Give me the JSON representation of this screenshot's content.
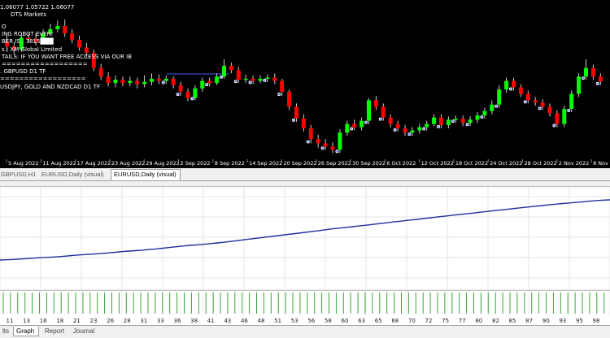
{
  "price_chart": {
    "header_values": "1.06077 1.05722 1.06077",
    "broker": "DTS Markets",
    "overlay_lines": [
      "O",
      "ING ROBOT EVER!",
      "BER IS : 7815███",
      "s : XM Global Limited",
      "TAILS: IF YOU WANT FREE ACCESS VIA OUR IB",
      "==================",
      ". GBPUSD D1 TF",
      "==================",
      "USDJPY, GOLD AND NZDCAD D1 TF"
    ],
    "date_labels": [
      "5 Aug 2022",
      "11 Aug 2022",
      "17 Aug 2022",
      "23 Aug 2022",
      "29 Aug 2022",
      "2 Sep 2022",
      "8 Sep 2022",
      "14 Sep 2022",
      "20 Sep 2022",
      "26 Sep 2022",
      "30 Sep 2022",
      "6 Oct 2022",
      "12 Oct 2022",
      "18 Oct 2022",
      "24 Oct 2022",
      "28 Oct 2022",
      "2 Nov 2022",
      "8 Nov"
    ],
    "bull_color": "#00ff00",
    "bear_color": "#ff0000",
    "candles": [
      {
        "o": 1.026,
        "c": 1.024,
        "h": 1.029,
        "l": 1.0215
      },
      {
        "o": 1.024,
        "c": 1.0225,
        "h": 1.026,
        "l": 1.0205
      },
      {
        "o": 1.0225,
        "c": 1.028,
        "h": 1.0295,
        "l": 1.0215
      },
      {
        "o": 1.028,
        "c": 1.0275,
        "h": 1.03,
        "l": 1.0255
      },
      {
        "o": 1.0275,
        "c": 1.026,
        "h": 1.03,
        "l": 1.0245
      },
      {
        "o": 1.026,
        "c": 1.03,
        "h": 1.032,
        "l": 1.025
      },
      {
        "o": 1.03,
        "c": 1.032,
        "h": 1.0345,
        "l": 1.029
      },
      {
        "o": 1.032,
        "c": 1.0335,
        "h": 1.036,
        "l": 1.0305
      },
      {
        "o": 1.0335,
        "c": 1.03,
        "h": 1.0365,
        "l": 1.0285
      },
      {
        "o": 1.03,
        "c": 1.027,
        "h": 1.032,
        "l": 1.0255
      },
      {
        "o": 1.027,
        "c": 1.0235,
        "h": 1.029,
        "l": 1.022
      },
      {
        "o": 1.0235,
        "c": 1.021,
        "h": 1.0255,
        "l": 1.019
      },
      {
        "o": 1.021,
        "c": 1.014,
        "h": 1.0225,
        "l": 1.0125
      },
      {
        "o": 1.014,
        "c": 1.01,
        "h": 1.016,
        "l": 1.0085
      },
      {
        "o": 1.01,
        "c": 1.007,
        "h": 1.012,
        "l": 1.0055
      },
      {
        "o": 1.007,
        "c": 1.0085,
        "h": 1.0105,
        "l": 1.005
      },
      {
        "o": 1.0085,
        "c": 1.007,
        "h": 1.01,
        "l": 1.0055
      },
      {
        "o": 1.007,
        "c": 1.008,
        "h": 1.01,
        "l": 1.0055
      },
      {
        "o": 1.008,
        "c": 1.0065,
        "h": 1.0095,
        "l": 1.0045
      },
      {
        "o": 1.0065,
        "c": 1.0075,
        "h": 1.0105,
        "l": 1.005
      },
      {
        "o": 1.0075,
        "c": 1.009,
        "h": 1.0115,
        "l": 1.006
      },
      {
        "o": 1.009,
        "c": 1.008,
        "h": 1.011,
        "l": 1.0065
      },
      {
        "o": 1.008,
        "c": 1.009,
        "h": 1.0105,
        "l": 1.0065
      },
      {
        "o": 1.009,
        "c": 1.006,
        "h": 1.01,
        "l": 1.0045
      },
      {
        "o": 1.006,
        "c": 1.003,
        "h": 1.0075,
        "l": 1.001
      },
      {
        "o": 1.003,
        "c": 1.0,
        "h": 1.0045,
        "l": 0.9985
      },
      {
        "o": 1.0,
        "c": 1.0045,
        "h": 1.006,
        "l": 0.999
      },
      {
        "o": 1.0045,
        "c": 1.008,
        "h": 1.0095,
        "l": 1.003
      },
      {
        "o": 1.008,
        "c": 1.007,
        "h": 1.0095,
        "l": 1.0055
      },
      {
        "o": 1.007,
        "c": 1.01,
        "h": 1.0115,
        "l": 1.006
      },
      {
        "o": 1.01,
        "c": 1.015,
        "h": 1.018,
        "l": 1.009
      },
      {
        "o": 1.015,
        "c": 1.013,
        "h": 1.0165,
        "l": 1.0115
      },
      {
        "o": 1.013,
        "c": 1.0085,
        "h": 1.0145,
        "l": 1.007
      },
      {
        "o": 1.0085,
        "c": 1.009,
        "h": 1.011,
        "l": 1.007
      },
      {
        "o": 1.009,
        "c": 1.008,
        "h": 1.0105,
        "l": 1.0065
      },
      {
        "o": 1.008,
        "c": 1.009,
        "h": 1.0105,
        "l": 1.007
      },
      {
        "o": 1.009,
        "c": 1.0095,
        "h": 1.011,
        "l": 1.0075
      },
      {
        "o": 1.0095,
        "c": 1.008,
        "h": 1.0115,
        "l": 1.0065
      },
      {
        "o": 1.008,
        "c": 1.003,
        "h": 1.009,
        "l": 1.001
      },
      {
        "o": 1.003,
        "c": 0.996,
        "h": 1.004,
        "l": 0.9945
      },
      {
        "o": 0.996,
        "c": 0.9905,
        "h": 0.9975,
        "l": 0.989
      },
      {
        "o": 0.9905,
        "c": 0.986,
        "h": 0.9925,
        "l": 0.9845
      },
      {
        "o": 0.986,
        "c": 0.981,
        "h": 0.9875,
        "l": 0.979
      },
      {
        "o": 0.981,
        "c": 0.979,
        "h": 0.983,
        "l": 0.977
      },
      {
        "o": 0.979,
        "c": 0.9775,
        "h": 0.981,
        "l": 0.976
      },
      {
        "o": 0.9775,
        "c": 0.976,
        "h": 0.9795,
        "l": 0.9745
      },
      {
        "o": 0.976,
        "c": 0.984,
        "h": 0.9855,
        "l": 0.9745
      },
      {
        "o": 0.984,
        "c": 0.988,
        "h": 0.9895,
        "l": 0.9825
      },
      {
        "o": 0.988,
        "c": 0.9865,
        "h": 0.99,
        "l": 0.985
      },
      {
        "o": 0.9865,
        "c": 0.9895,
        "h": 0.991,
        "l": 0.985
      },
      {
        "o": 0.9895,
        "c": 0.999,
        "h": 1.0,
        "l": 0.988
      },
      {
        "o": 0.999,
        "c": 0.996,
        "h": 1.001,
        "l": 0.9945
      },
      {
        "o": 0.996,
        "c": 0.991,
        "h": 0.9975,
        "l": 0.9895
      },
      {
        "o": 0.991,
        "c": 0.988,
        "h": 0.9925,
        "l": 0.9865
      },
      {
        "o": 0.988,
        "c": 0.986,
        "h": 0.9895,
        "l": 0.9845
      },
      {
        "o": 0.986,
        "c": 0.984,
        "h": 0.9875,
        "l": 0.9825
      },
      {
        "o": 0.984,
        "c": 0.985,
        "h": 0.9865,
        "l": 0.9825
      },
      {
        "o": 0.985,
        "c": 0.9865,
        "h": 0.988,
        "l": 0.9835
      },
      {
        "o": 0.9865,
        "c": 0.988,
        "h": 0.9895,
        "l": 0.985
      },
      {
        "o": 0.988,
        "c": 0.991,
        "h": 0.9925,
        "l": 0.987
      },
      {
        "o": 0.991,
        "c": 0.9875,
        "h": 0.9925,
        "l": 0.986
      },
      {
        "o": 0.9875,
        "c": 0.99,
        "h": 0.9915,
        "l": 0.986
      },
      {
        "o": 0.99,
        "c": 0.9905,
        "h": 0.992,
        "l": 0.9885
      },
      {
        "o": 0.9905,
        "c": 0.9885,
        "h": 0.992,
        "l": 0.987
      },
      {
        "o": 0.9885,
        "c": 0.99,
        "h": 0.9915,
        "l": 0.987
      },
      {
        "o": 0.99,
        "c": 0.992,
        "h": 0.9935,
        "l": 0.9885
      },
      {
        "o": 0.992,
        "c": 0.994,
        "h": 0.9955,
        "l": 0.9905
      },
      {
        "o": 0.994,
        "c": 0.997,
        "h": 0.999,
        "l": 0.9925
      },
      {
        "o": 0.997,
        "c": 1.004,
        "h": 1.006,
        "l": 0.9955
      },
      {
        "o": 1.004,
        "c": 1.008,
        "h": 1.0095,
        "l": 1.0025
      },
      {
        "o": 1.008,
        "c": 1.005,
        "h": 1.0095,
        "l": 1.0035
      },
      {
        "o": 1.005,
        "c": 1.002,
        "h": 1.0065,
        "l": 1.0005
      },
      {
        "o": 1.002,
        "c": 0.999,
        "h": 1.0035,
        "l": 0.9975
      },
      {
        "o": 0.999,
        "c": 0.998,
        "h": 1.0005,
        "l": 0.9965
      },
      {
        "o": 0.998,
        "c": 0.996,
        "h": 0.9995,
        "l": 0.9945
      },
      {
        "o": 0.996,
        "c": 0.993,
        "h": 0.9975,
        "l": 0.9915
      },
      {
        "o": 0.993,
        "c": 0.988,
        "h": 0.9945,
        "l": 0.9865
      },
      {
        "o": 0.988,
        "c": 0.995,
        "h": 0.9965,
        "l": 0.9865
      },
      {
        "o": 0.995,
        "c": 1.002,
        "h": 1.0035,
        "l": 0.9935
      },
      {
        "o": 1.002,
        "c": 1.01,
        "h": 1.0115,
        "l": 1.0005
      },
      {
        "o": 1.01,
        "c": 1.014,
        "h": 1.018,
        "l": 1.0085
      },
      {
        "o": 1.014,
        "c": 1.01,
        "h": 1.0155,
        "l": 1.0085
      },
      {
        "o": 1.01,
        "c": 1.0077,
        "h": 1.0115,
        "l": 1.006
      }
    ]
  },
  "chart_tabs": [
    "GBPUSD,H1",
    "EURUSD,Daily (visual)",
    "EURUSD,Daily (visual)"
  ],
  "balance_graph": {
    "line_color": "#1f2f9e",
    "points": [
      0,
      0.4,
      1.0,
      1.6,
      2.3,
      3.1,
      3.9,
      4.4,
      5.0,
      5.8,
      6.8,
      7.8,
      8.7,
      9.3,
      10.0,
      10.9,
      11.8,
      12.9,
      13.9,
      14.8,
      15.5,
      16.3,
      17.4,
      18.4,
      19.6,
      20.8,
      22.0,
      23.3,
      24.3,
      25.2,
      26.1,
      27.2,
      28.4,
      29.5,
      30.8,
      32.2,
      33.6,
      35.0,
      36.4,
      37.8,
      39.1,
      40.5,
      41.9,
      43.2,
      44.6,
      46.0,
      47.4,
      48.8,
      50.3,
      51.7,
      53.0,
      54.2,
      55.4,
      56.6,
      57.9,
      59.2,
      60.6,
      61.9,
      63.2,
      64.5,
      65.8,
      67.0,
      68.3,
      69.6,
      70.8,
      72.1,
      73.4,
      74.7,
      75.9,
      77.1,
      78.3,
      79.6,
      80.9,
      82.1,
      83.4,
      84.6,
      85.8,
      87.0,
      88.2,
      89.4,
      90.6,
      91.8,
      92.9,
      93.9,
      94.9,
      95.8,
      96.8,
      97.8,
      98.8,
      99.6,
      100
    ]
  },
  "histogram": {
    "bar_color": "#3aa23a",
    "axis_labels": [
      "11",
      "13",
      "16",
      "18",
      "21",
      "23",
      "26",
      "28",
      "31",
      "33",
      "36",
      "38",
      "41",
      "43",
      "46",
      "48",
      "51",
      "53",
      "56",
      "58",
      "60",
      "63",
      "65",
      "68",
      "70",
      "72",
      "75",
      "77",
      "80",
      "82",
      "85",
      "87",
      "90",
      "93",
      "95",
      "98"
    ]
  },
  "bottom_tabs": [
    "lts",
    "Graph",
    "Report",
    "Journal"
  ]
}
